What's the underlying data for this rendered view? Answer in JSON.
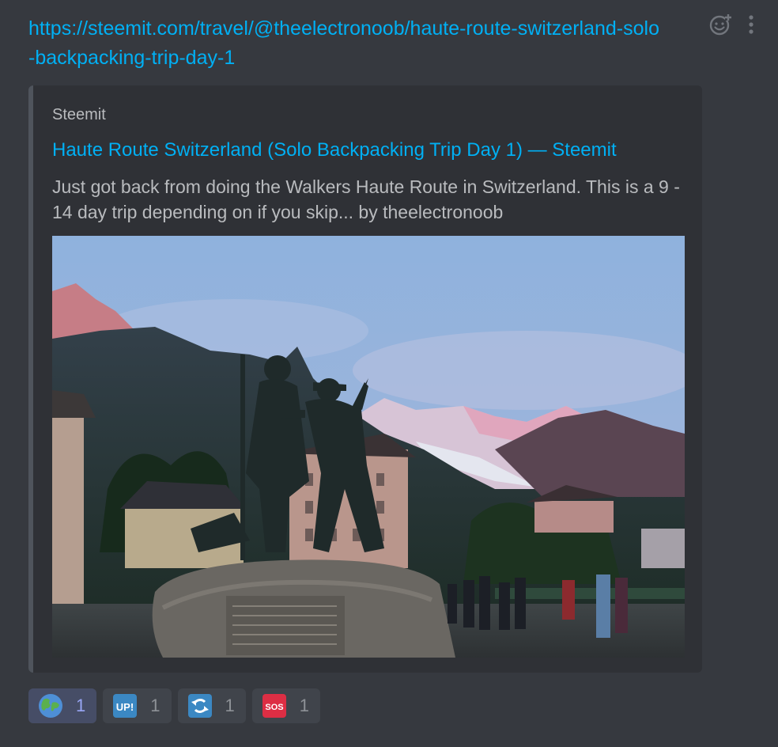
{
  "message": {
    "link_text": "https://steemit.com/travel/@theelectronoob/haute-route-switzerland-solo-backpacking-trip-day-1",
    "actions": {
      "add_reaction_icon": "add-reaction-icon",
      "more_icon": "more-options-icon"
    }
  },
  "embed": {
    "provider": "Steemit",
    "title": "Haute Route Switzerland (Solo Backpacking Trip Day 1) — Steemit",
    "description": "Just got back from doing the Walkers Haute Route in Switzerland. This is a 9 - 14 day trip depending on if you skip... by theelectronoob",
    "image_icon": "statue-mountain-photo"
  },
  "reactions": [
    {
      "emoji": "globe",
      "count": "1",
      "active": true
    },
    {
      "emoji": "up",
      "label": "UP!",
      "count": "1",
      "active": false
    },
    {
      "emoji": "arrows-counterclockwise",
      "count": "1",
      "active": false
    },
    {
      "emoji": "sos",
      "label": "SOS",
      "count": "1",
      "active": false
    }
  ],
  "colors": {
    "background": "#36393f",
    "embed_bg": "#2f3136",
    "link": "#00b0f4",
    "embed_border": "#4f545c"
  }
}
